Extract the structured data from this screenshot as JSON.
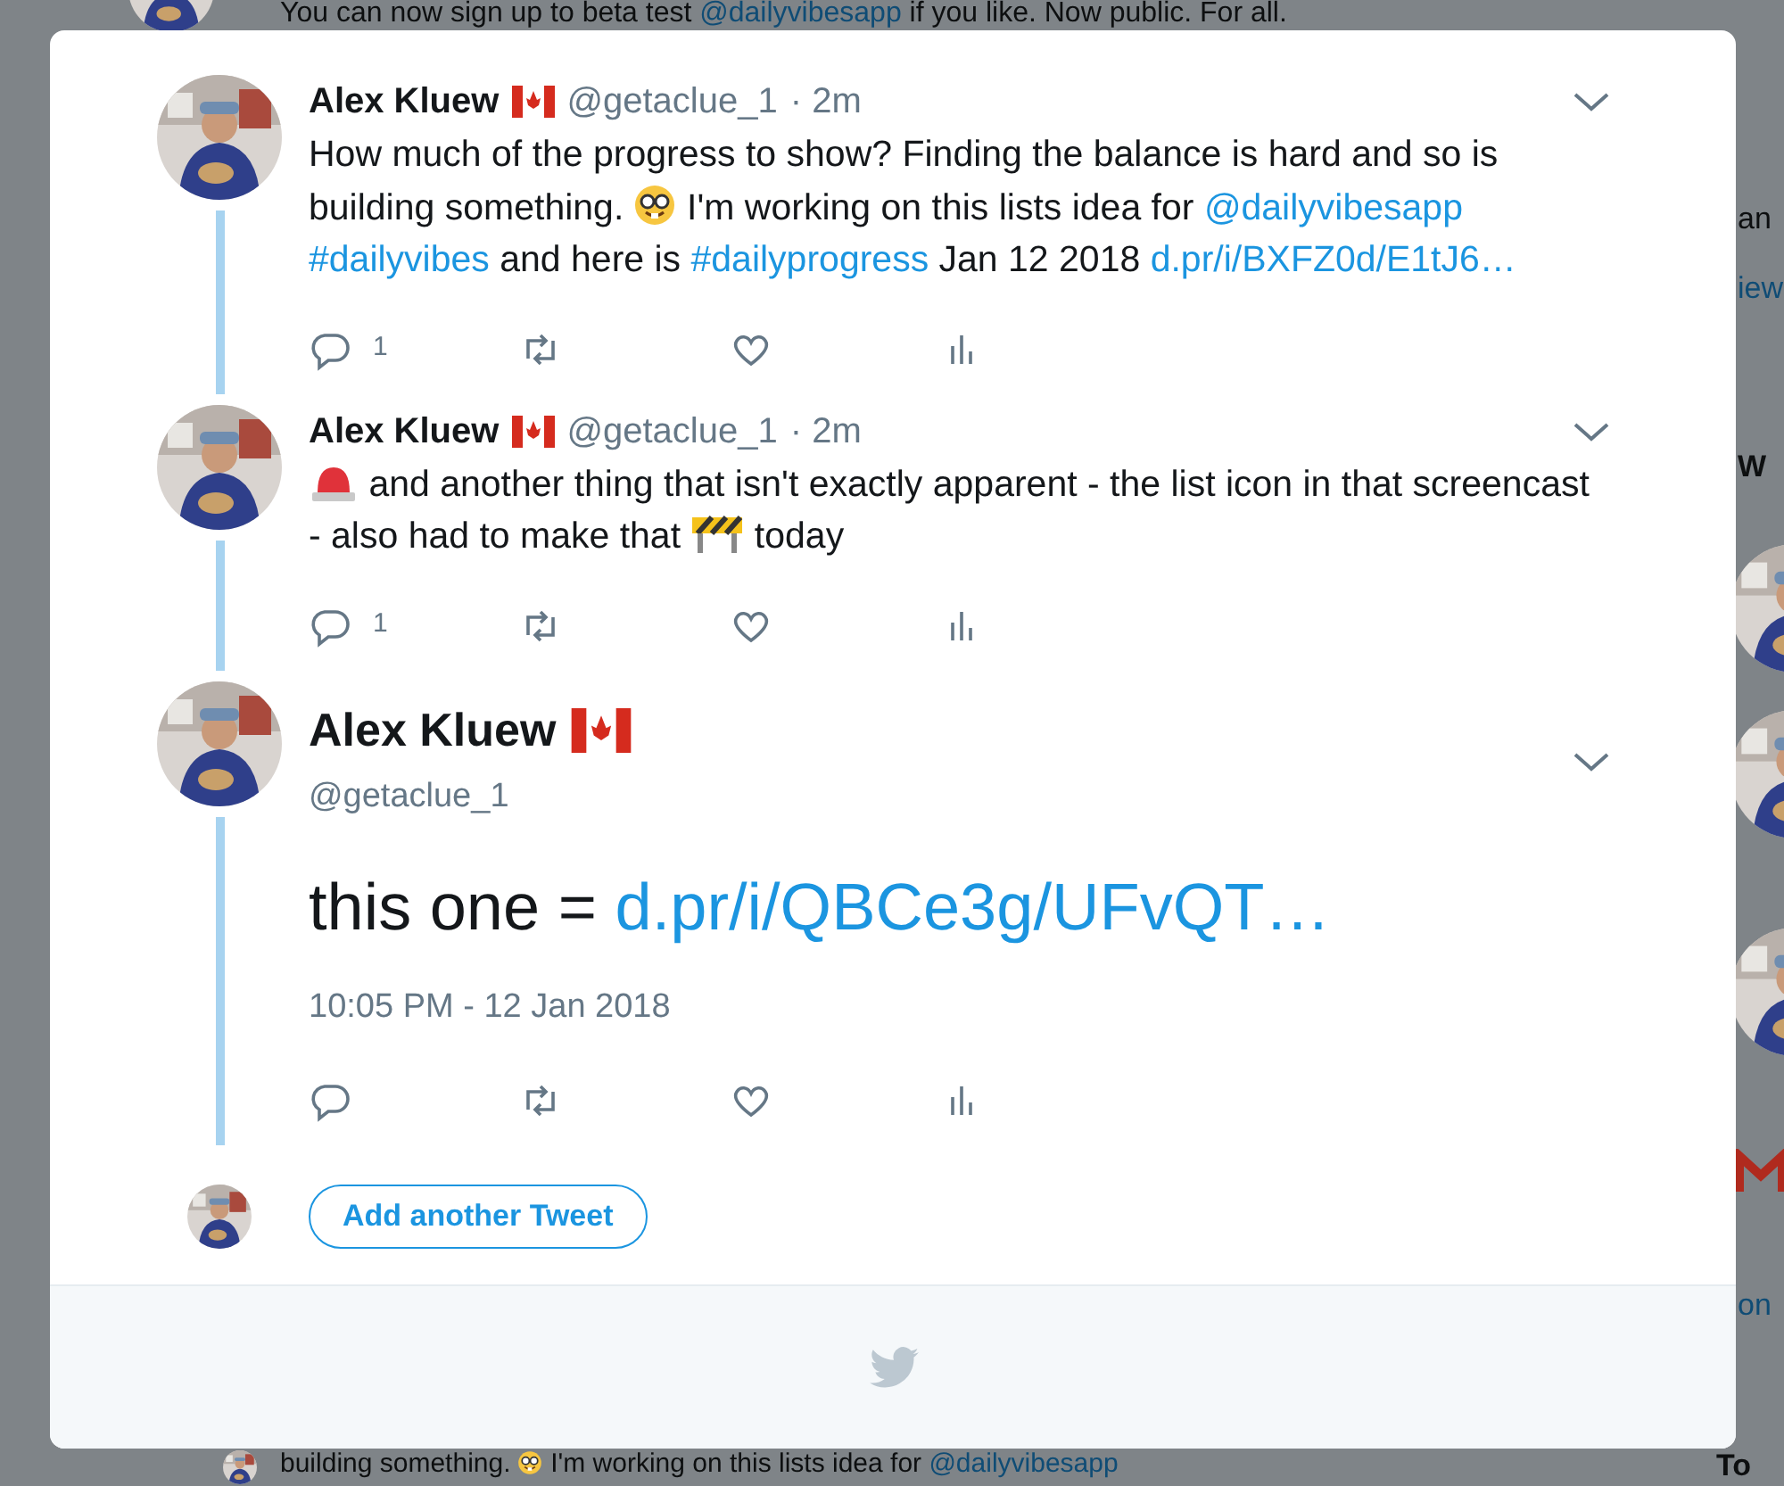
{
  "backdrop": {
    "top_text": [
      {
        "kind": "text",
        "text": "You can now sign up to beta test "
      },
      {
        "kind": "link",
        "text": "@dailyvibesapp"
      },
      {
        "kind": "text",
        "text": " if you like. Now public. For all."
      }
    ],
    "bottom_text": [
      {
        "kind": "text",
        "text": "building something. "
      },
      {
        "kind": "nerd-emoji"
      },
      {
        "kind": "text",
        "text": " I'm working on this lists idea for "
      },
      {
        "kind": "link",
        "text": "@dailyvibesapp"
      }
    ],
    "side_fragments": [
      {
        "kind": "text",
        "text": "an"
      },
      {
        "kind": "link",
        "text": "iew"
      },
      {
        "kind": "heading",
        "text": "W"
      },
      {
        "kind": "link",
        "text": "on"
      },
      {
        "kind": "heading",
        "text": "To"
      }
    ]
  },
  "tweets": [
    {
      "kind": "reply",
      "name": "Alex Kluew",
      "handle": "@getaclue_1",
      "time": "· 2m",
      "reply_count": "1",
      "text": [
        {
          "kind": "text",
          "text": "How much of the progress to show? Finding the balance is hard and so is building something. "
        },
        {
          "kind": "nerd-emoji"
        },
        {
          "kind": "text",
          "text": " I'm working on this lists idea for "
        },
        {
          "kind": "link",
          "text": "@dailyvibesapp"
        },
        {
          "kind": "space"
        },
        {
          "kind": "link",
          "text": "#dailyvibes"
        },
        {
          "kind": "text",
          "text": " and here is "
        },
        {
          "kind": "link",
          "text": "#dailyprogress"
        },
        {
          "kind": "text",
          "text": " Jan 12 2018 "
        },
        {
          "kind": "link",
          "text": "d.pr/i/BXFZ0d/E1tJ6…"
        }
      ]
    },
    {
      "kind": "reply",
      "name": "Alex Kluew",
      "handle": "@getaclue_1",
      "time": "· 2m",
      "reply_count": "1",
      "text": [
        {
          "kind": "siren-emoji"
        },
        {
          "kind": "text",
          "text": " and another thing that isn't exactly apparent - the list icon in that screencast - also had to make that "
        },
        {
          "kind": "barrier-emoji"
        },
        {
          "kind": "text",
          "text": " today"
        }
      ]
    },
    {
      "kind": "focused",
      "name": "Alex Kluew",
      "handle": "@getaclue_1",
      "timestamp": "10:05 PM - 12 Jan 2018",
      "text": [
        {
          "kind": "text",
          "text": "this one = "
        },
        {
          "kind": "link",
          "text": "d.pr/i/QBCe3g/UFvQT…"
        }
      ]
    }
  ],
  "add_button": "Add another Tweet"
}
